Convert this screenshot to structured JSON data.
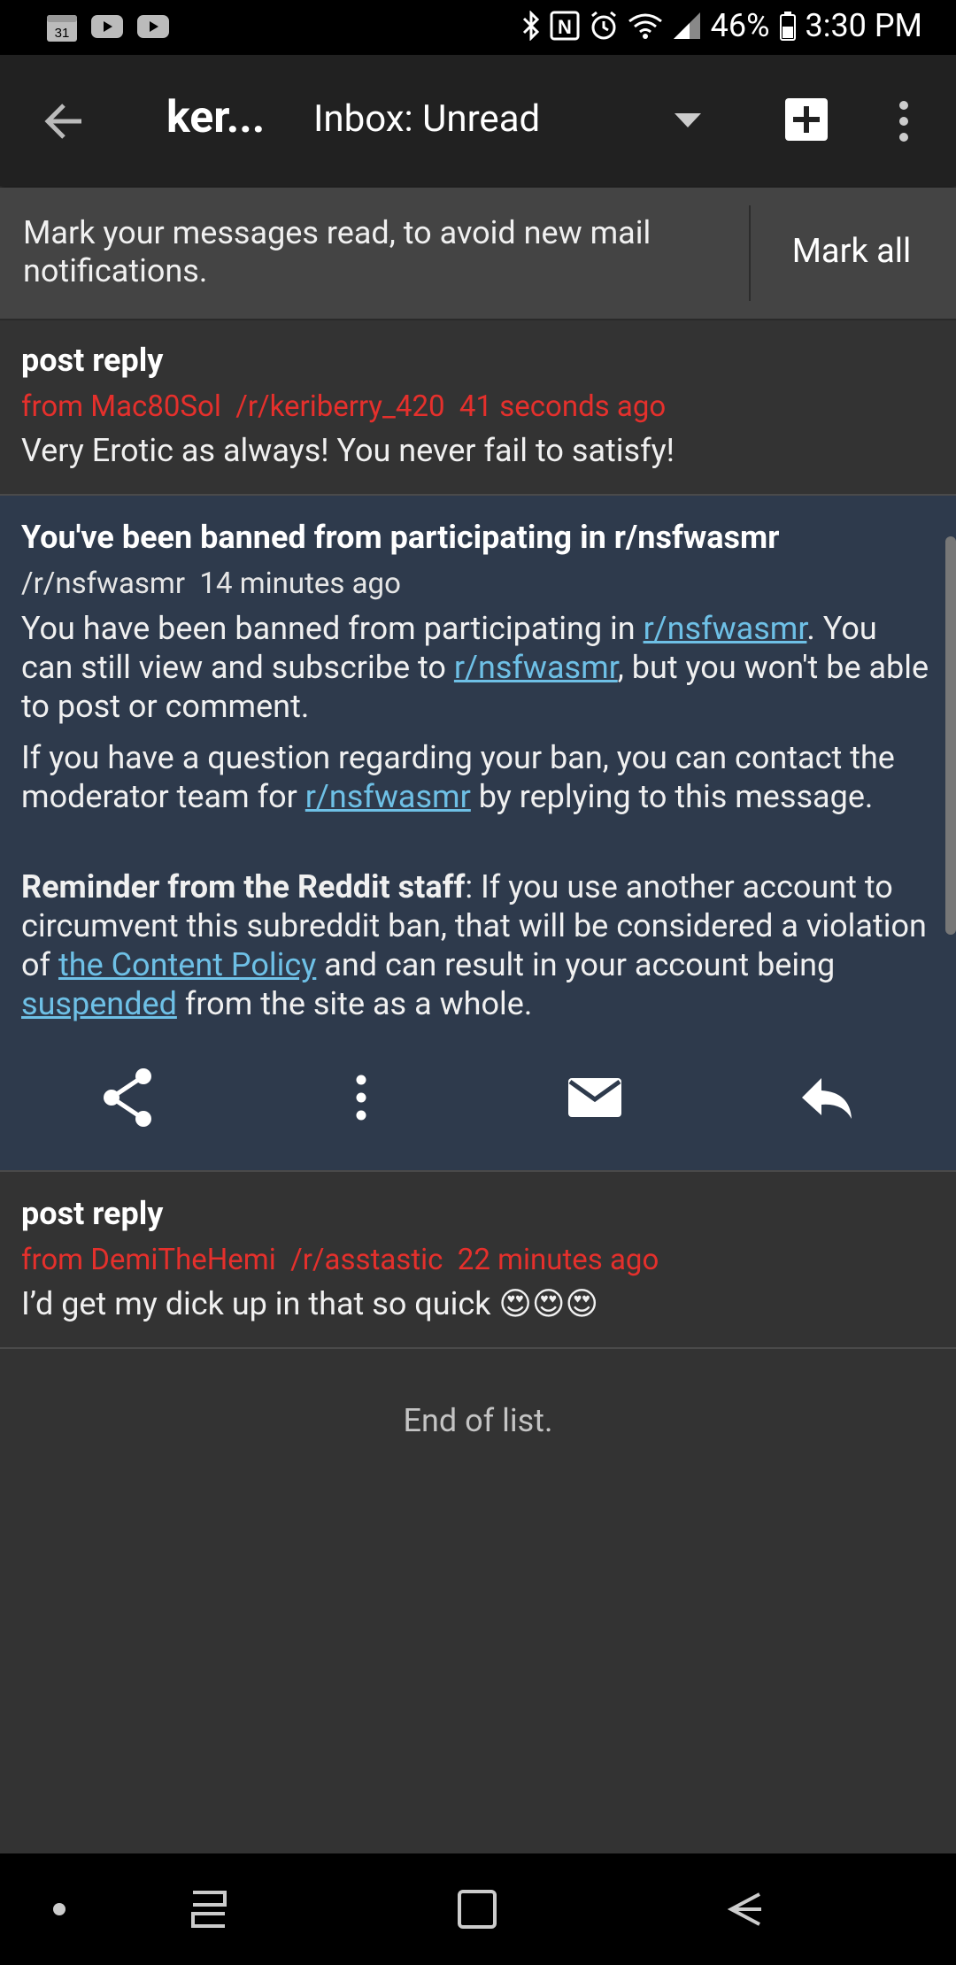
{
  "status_bar": {
    "battery_percent": "46%",
    "time": "3:30 PM",
    "left_icons": [
      "calendar-icon",
      "youtube-icon",
      "youtube-icon"
    ],
    "calendar_day": "31"
  },
  "toolbar": {
    "title": "ker...",
    "inbox_filter": "Inbox: Unread"
  },
  "banner": {
    "text": "Mark your messages read, to avoid new mail notifications.",
    "mark_all_label": "Mark all"
  },
  "messages": [
    {
      "subject": "post reply",
      "meta": "from Mac80Sol  /r/keriberry_420  41 seconds ago",
      "body": "Very Erotic as always! You never fail to satisfy!"
    },
    {
      "subject": "You've been banned from participating in r/nsfwasmr",
      "meta": "/r/nsfwasmr  14 minutes ago",
      "p1_a": "You have been banned from participating in ",
      "link1": "r/nsfwasmr",
      "p1_b": ". You can still view and subscribe to ",
      "link2": "r/nsfwasmr",
      "p1_c": ", but you won't be able to post or comment.",
      "p2_a": "If you have a question regarding your ban, you can contact the moderator team for ",
      "link3": "r/nsfwasmr",
      "p2_b": " by replying to this message.",
      "p3_bold": "Reminder from the Reddit staff",
      "p3_a": ": If you use another account to circumvent this subreddit ban, that will be considered a violation of ",
      "link4": "the Content Policy",
      "p3_b": " and can result in your account being ",
      "link5": "suspended",
      "p3_c": " from the site as a whole."
    },
    {
      "subject": "post reply",
      "meta": "from DemiTheHemi  /r/asstastic  22 minutes ago",
      "body": "I’d get my dick up in that so quick 😍😍😍"
    }
  ],
  "end_of_list": "End of list."
}
